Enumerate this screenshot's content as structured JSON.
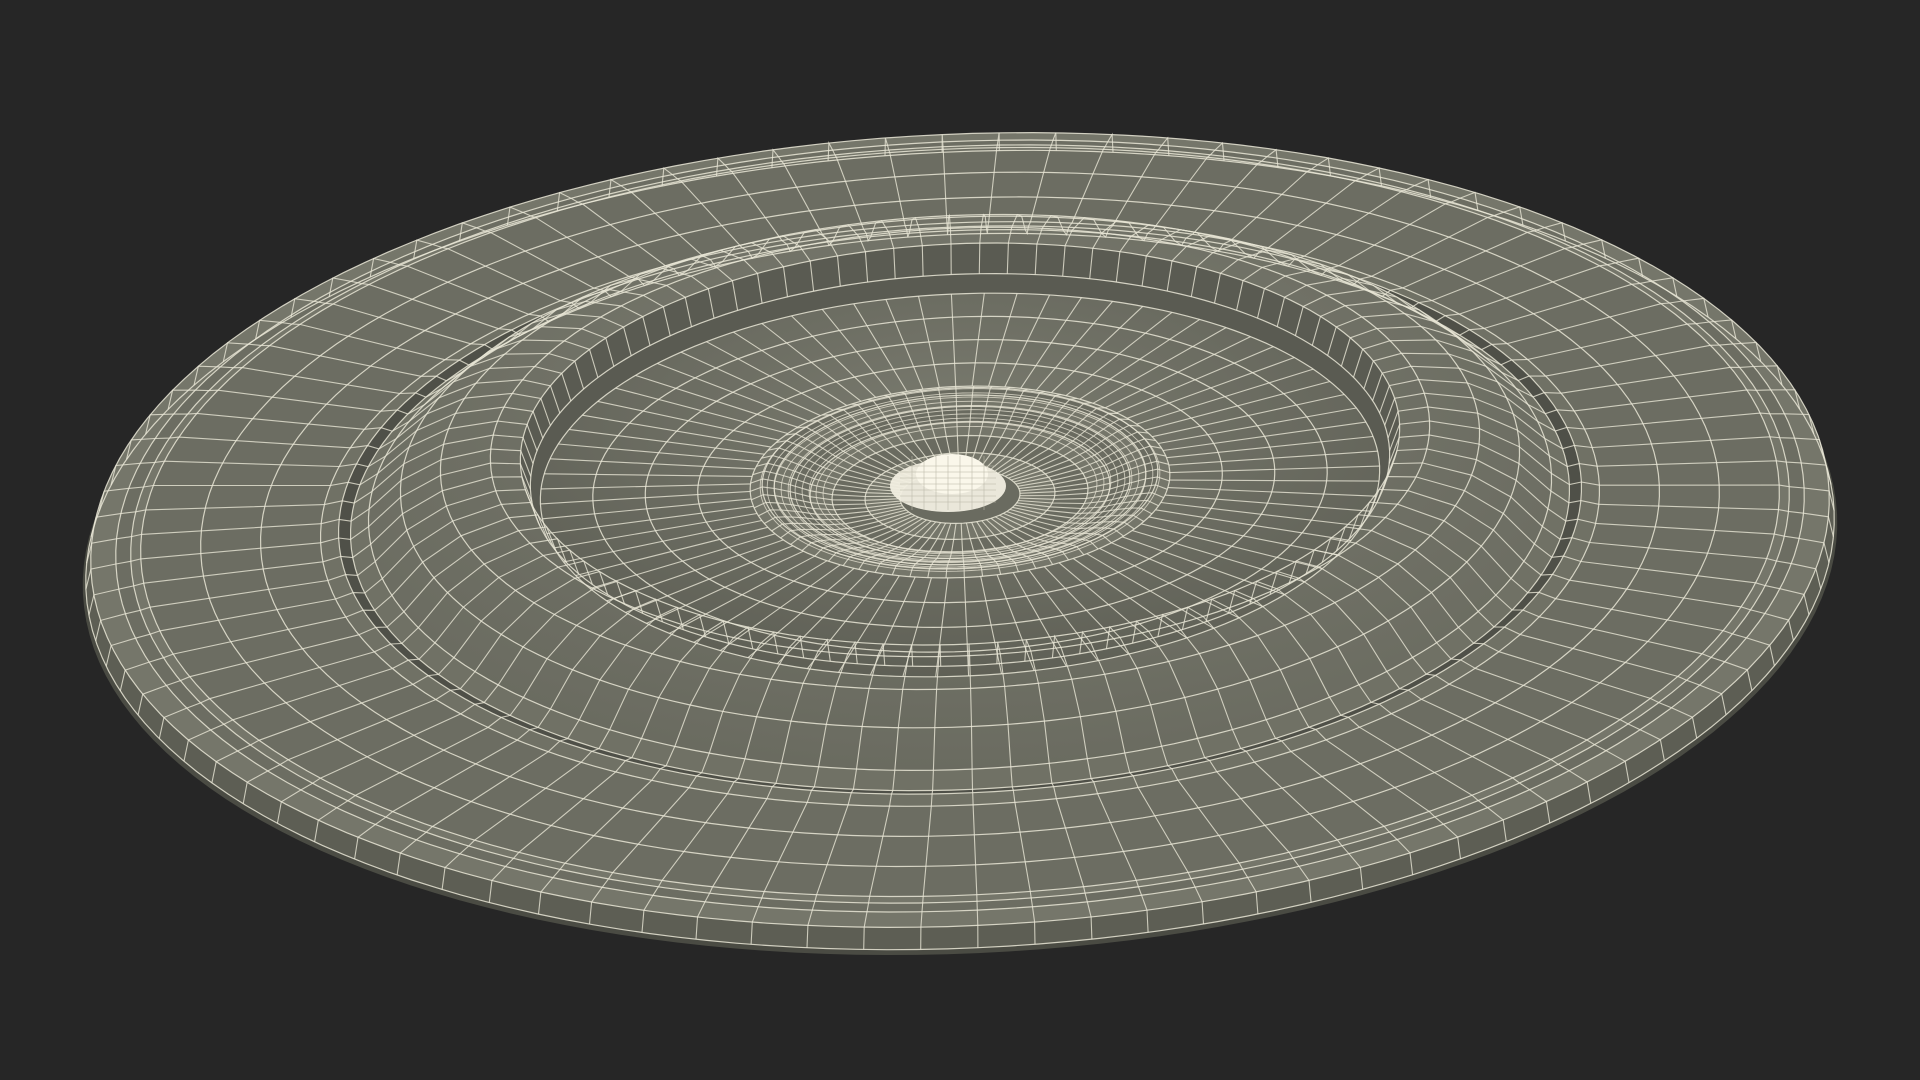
{
  "scene": {
    "subject": "wireframe-dish-model",
    "colors": {
      "background": "#262626",
      "surface_light": "#7d7e72",
      "surface_mid": "#6f7064",
      "surface_dark": "#55564c",
      "wire": "#e9e6d6",
      "center_detail": "#f1eee0"
    }
  }
}
